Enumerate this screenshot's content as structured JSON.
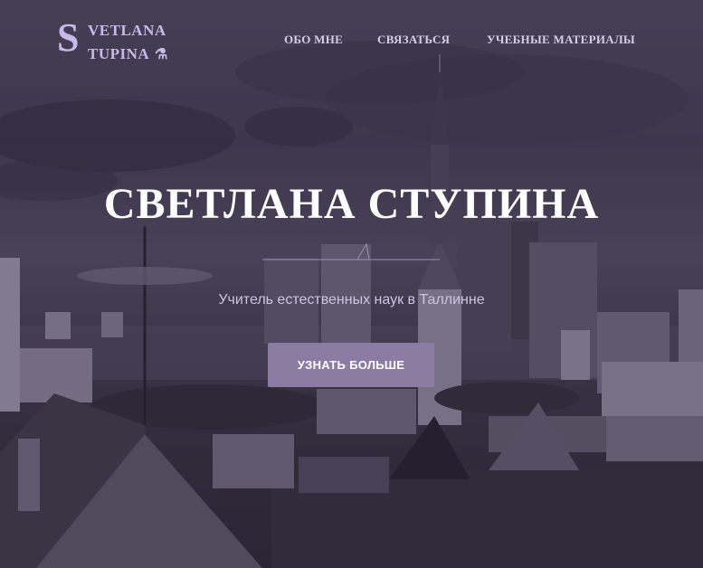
{
  "logo": {
    "initial": "S",
    "line1": "VETLANA",
    "line2": "TUPINA",
    "icon": "flask-icon"
  },
  "nav": {
    "items": [
      {
        "label": "ОБО МНЕ"
      },
      {
        "label": "СВЯЗАТЬСЯ"
      },
      {
        "label": "УЧЕБНЫЕ МАТЕРИАЛЫ"
      }
    ]
  },
  "hero": {
    "title": "СВЕТЛАНА СТУПИНА",
    "subtitle": "Учитель естественных наук в Таллинне",
    "cta_label": "УЗНАТЬ БОЛЬШЕ",
    "overlay_color": "#3c2d55",
    "accent_color": "#8c7ca3"
  }
}
